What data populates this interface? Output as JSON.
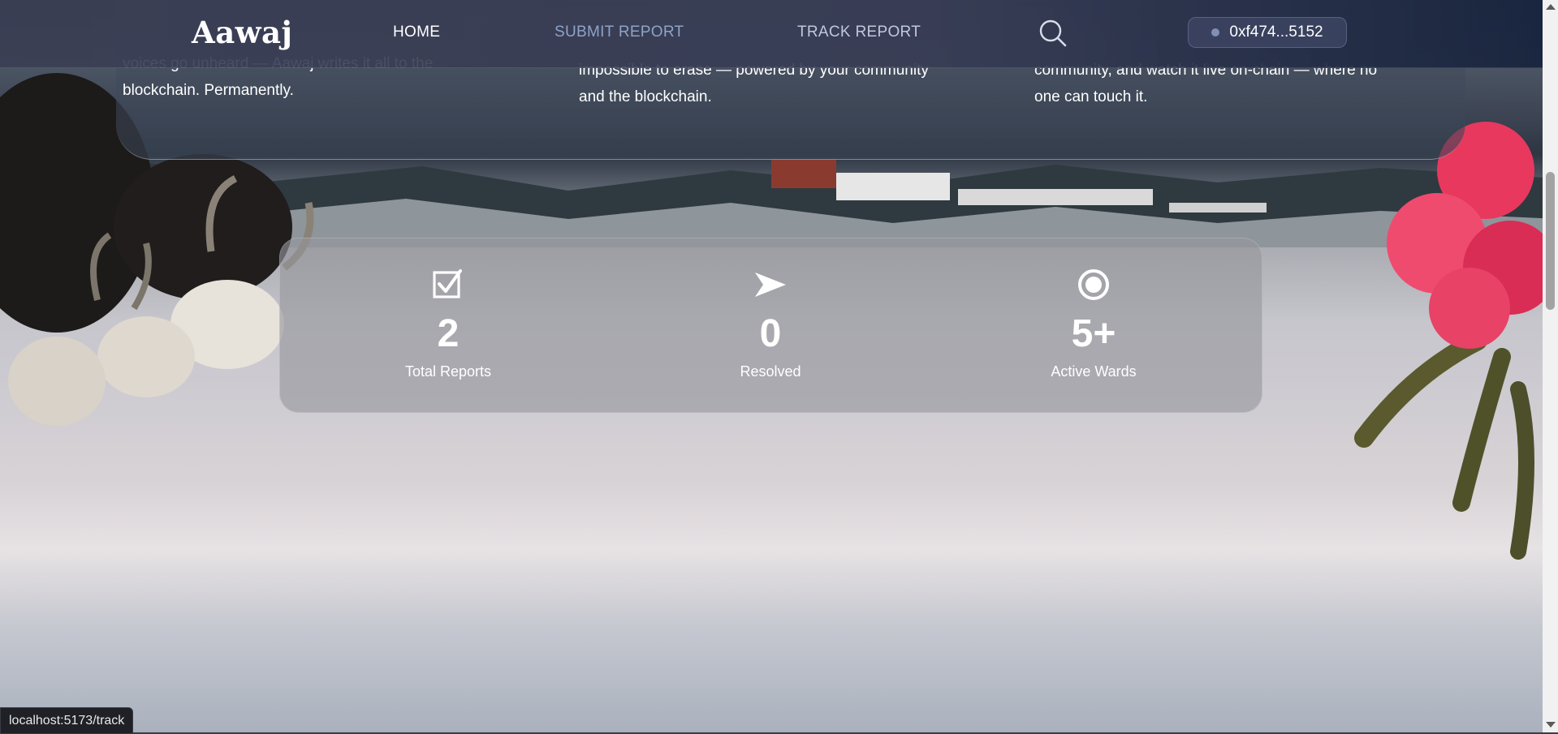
{
  "navbar": {
    "logo": "Aawaj",
    "links": {
      "home": "HOME",
      "submit": "SUBMIT REPORT",
      "track": "TRACK REPORT"
    },
    "search_icon": "search-icon",
    "wallet": "0xf474...5152"
  },
  "features": [
    {
      "line1": "voices go unheard — Aawaj writes it all to the",
      "line2": "blockchain. Permanently."
    },
    {
      "line1": "impossible to erase — powered by your community",
      "line2": "and the blockchain."
    },
    {
      "line1": "community, and watch it live on-chain — where no",
      "line2": "one can touch it."
    }
  ],
  "stats": [
    {
      "icon": "checkbox-icon",
      "value": "2",
      "label": "Total Reports"
    },
    {
      "icon": "send-arrow-icon",
      "value": "0",
      "label": "Resolved"
    },
    {
      "icon": "target-icon",
      "value": "5+",
      "label": "Active Wards"
    }
  ],
  "status_bar": {
    "url": "localhost:5173/track"
  },
  "colors": {
    "nav_active": "#ffffff",
    "nav_submit": "#8ea3c7",
    "nav_track": "#c0c8dc",
    "wallet_dot": "#8090b4"
  }
}
